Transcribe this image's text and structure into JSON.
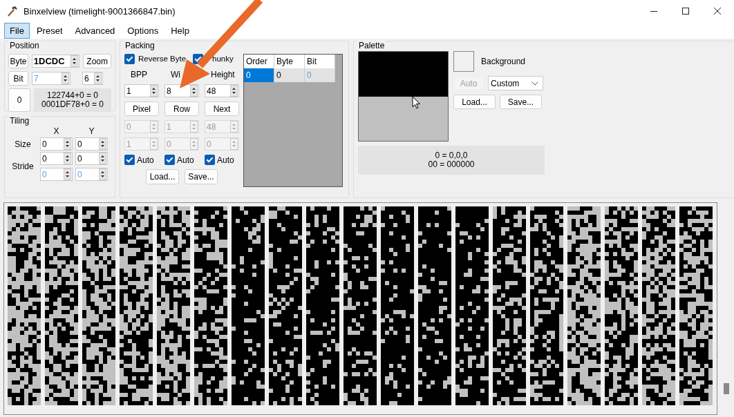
{
  "window": {
    "title": "Binxelview (timelight-9001366847.bin)"
  },
  "menu": [
    {
      "label": "File",
      "selected": true
    },
    {
      "label": "Preset",
      "selected": false
    },
    {
      "label": "Advanced",
      "selected": false
    },
    {
      "label": "Options",
      "selected": false
    },
    {
      "label": "Help",
      "selected": false
    }
  ],
  "position": {
    "title": "Position",
    "byte_button": "Byte",
    "byte_value": "1DCDC",
    "zoom_button": "Zoom",
    "bit_button": "Bit",
    "bit_value": {
      "value": "7",
      "highlighted": true
    },
    "zoom_value": {
      "value": "6",
      "highlighted": false
    },
    "reset_button": "0",
    "info": [
      "122744+0 = 0",
      "0001DF78+0 = 0"
    ]
  },
  "tiling": {
    "title": "Tiling",
    "x_label": "X",
    "y_label": "Y",
    "rows": [
      {
        "label": "Size",
        "lines": [
          [
            {
              "value": "0",
              "highlighted": false
            },
            {
              "value": "0",
              "highlighted": false
            }
          ]
        ]
      },
      {
        "label": "Stride",
        "lines": [
          [
            {
              "value": "0",
              "highlighted": false
            },
            {
              "value": "0",
              "highlighted": false
            }
          ],
          [
            {
              "value": "0",
              "highlighted": true
            },
            {
              "value": "0",
              "highlighted": true
            }
          ]
        ]
      }
    ]
  },
  "packing": {
    "title": "Packing",
    "checks": [
      {
        "label": "Reverse Byte",
        "checked": true
      },
      {
        "label": "hunky",
        "checked": true
      }
    ],
    "columns": [
      {
        "label": "BPP",
        "value": "1",
        "button": "Pixel",
        "strides": [
          {
            "value": "0",
            "disabled": true
          },
          {
            "value": "1",
            "disabled": true
          }
        ],
        "auto": {
          "label": "Auto",
          "checked": true
        }
      },
      {
        "label": "Wi",
        "value": "8",
        "button": "Row",
        "strides": [
          {
            "value": "1",
            "disabled": true
          },
          {
            "value": "0",
            "disabled": true
          }
        ],
        "auto": {
          "label": "Auto",
          "checked": true
        }
      },
      {
        "label": "Height",
        "value": "48",
        "button": "Next",
        "strides": [
          {
            "value": "48",
            "disabled": true
          },
          {
            "value": "0",
            "disabled": true
          }
        ],
        "auto": {
          "label": "Auto",
          "checked": true
        }
      }
    ],
    "load": "Load...",
    "save": "Save...",
    "order_table": {
      "columns": [
        "Order",
        "Byte",
        "Bit"
      ],
      "rows": [
        {
          "cells": [
            {
              "text": "0",
              "selected": true,
              "highlighted": false
            },
            {
              "text": "0",
              "selected": false,
              "highlighted": false
            },
            {
              "text": "0",
              "selected": false,
              "highlighted": true
            }
          ]
        }
      ]
    }
  },
  "palette": {
    "title": "Palette",
    "swatches": [
      {
        "color": "#000000"
      },
      {
        "color": "#c0c0c0"
      }
    ],
    "background": {
      "label": "Background",
      "color": "#f0f0f0"
    },
    "auto": {
      "label": "Auto",
      "disabled": true
    },
    "mode": "Custom",
    "load": "Load...",
    "save": "Save...",
    "info": [
      "0 = 0,0,0",
      "00 = 000000"
    ]
  }
}
